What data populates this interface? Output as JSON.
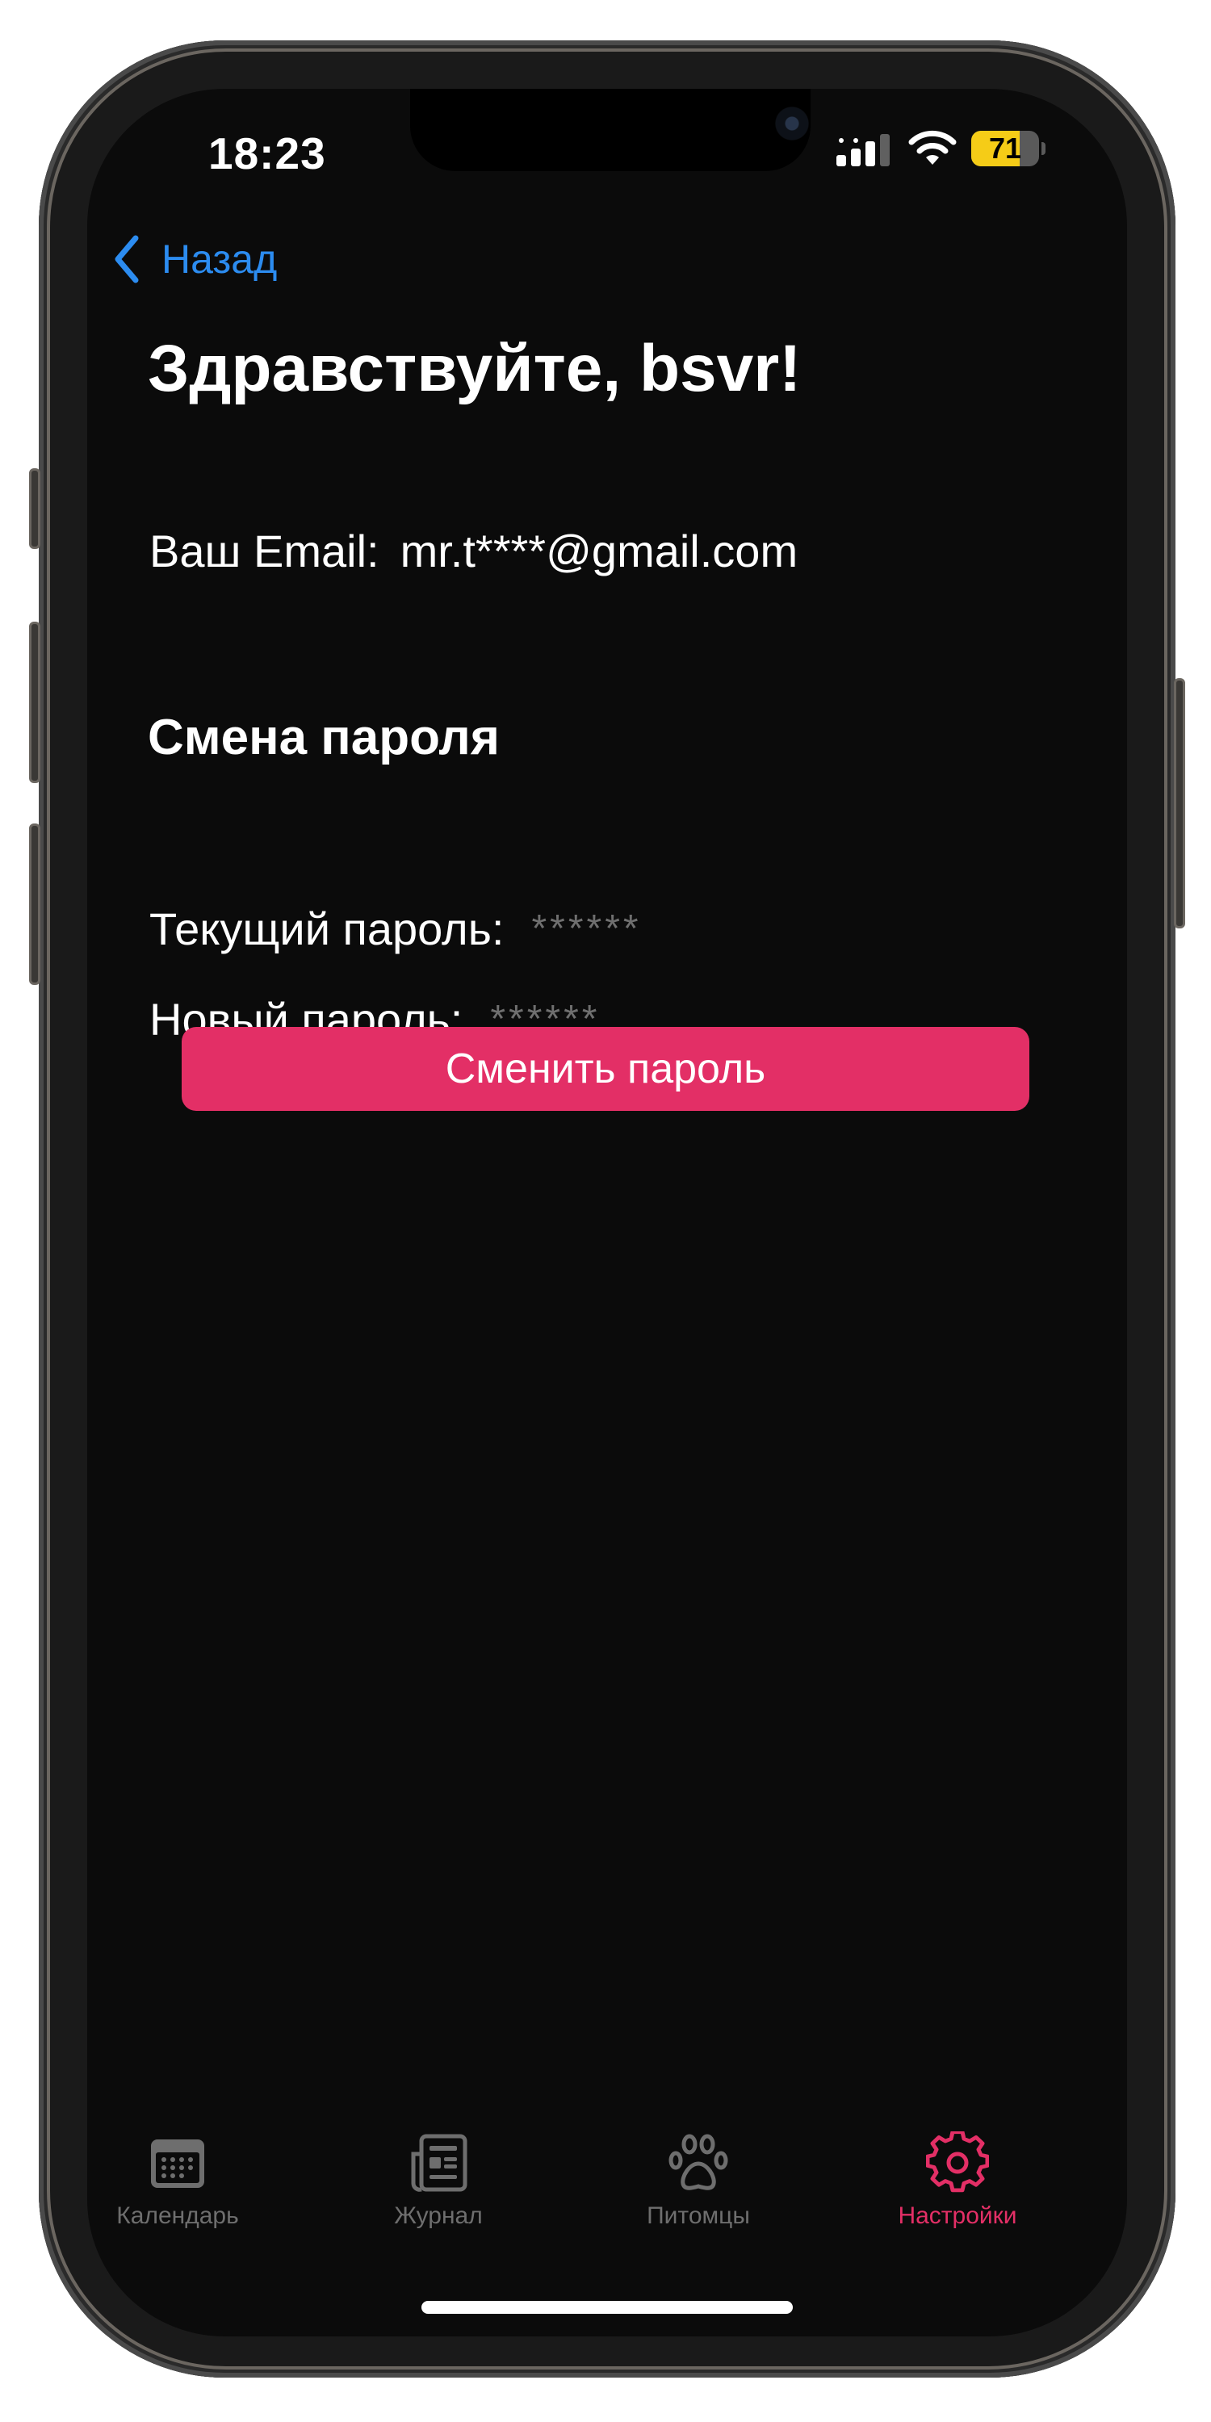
{
  "status_bar": {
    "time": "18:23",
    "battery": "71",
    "battery_level": 0.71,
    "battery_color": "#f5cc17",
    "icons": [
      "signal-icon",
      "wifi-icon",
      "battery-icon"
    ]
  },
  "nav": {
    "back_label": "Назад",
    "back_icon": "chevron-left-icon"
  },
  "profile": {
    "greeting": "Здравствуйте, bsvr!",
    "email_label": "Ваш Email:",
    "email_value": "mr.t****@gmail.com"
  },
  "password_change": {
    "title": "Смена пароля",
    "current_label": "Текущий пароль:",
    "current_placeholder": "******",
    "new_label": "Новый пароль:",
    "new_placeholder": "******",
    "submit_label": "Сменить пароль"
  },
  "tabbar": {
    "items": [
      {
        "label": "Календарь",
        "icon": "calendar-icon",
        "active": false
      },
      {
        "label": "Журнал",
        "icon": "newspaper-icon",
        "active": false
      },
      {
        "label": "Питомцы",
        "icon": "paw-icon",
        "active": false
      },
      {
        "label": "Настройки",
        "icon": "gear-icon",
        "active": true
      }
    ]
  },
  "colors": {
    "accent": "#e32f66",
    "link": "#2c8cf0",
    "background": "#0b0b0b",
    "inactive_tab": "#6e6e6e"
  }
}
